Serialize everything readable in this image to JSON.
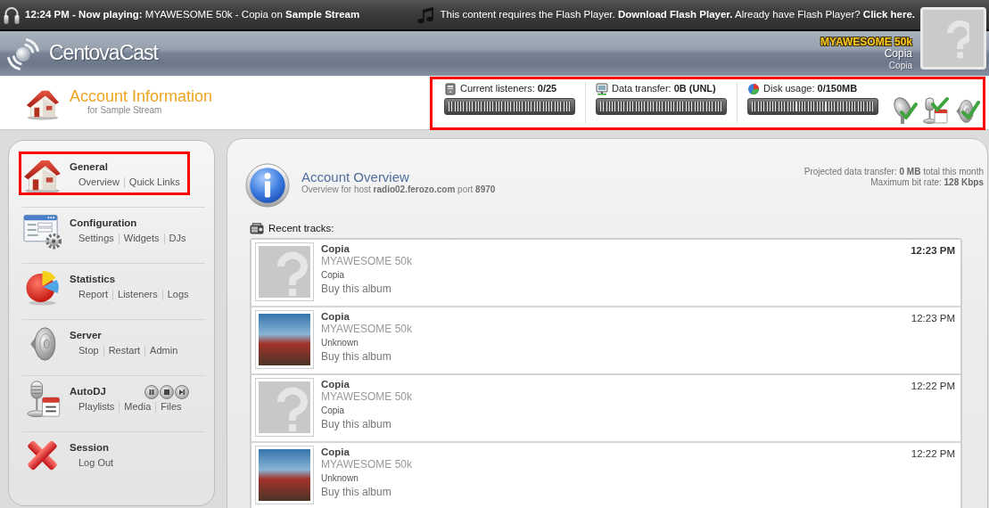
{
  "now_playing_bar": {
    "status": "**12:24 PM - Now playing:** MYAWESOME 50k - Copia on **Sample Stream**",
    "flash_notice": [
      {
        "kind": "text",
        "text": "This content requires the Flash Player."
      },
      {
        "kind": "link",
        "text": "Download Flash Player."
      },
      {
        "kind": "text",
        "text": "Already have Flash Player?"
      },
      {
        "kind": "link",
        "text": "Click here."
      }
    ]
  },
  "album_art": {
    "kind": "placeholder"
  },
  "header": {
    "logo": "CentovaCast",
    "now_playing": {
      "artist": "MYAWESOME 50k",
      "title": "Copia",
      "album": "Copia"
    }
  },
  "page_title": {
    "title": "Account Information",
    "subtitle": "for Sample Stream"
  },
  "usage": {
    "highlighted": true,
    "meters": [
      {
        "kind": "listeners",
        "label": "Current listeners:",
        "value": "0/25",
        "level": 0
      },
      {
        "kind": "transfer",
        "label": "Data transfer:",
        "value": "0B (UNL)",
        "level": 0
      },
      {
        "kind": "disk",
        "label": "Disk usage:",
        "value": "0/150MB",
        "level": 0
      }
    ]
  },
  "sidebar": {
    "items": [
      {
        "kind": "general",
        "title": "General",
        "links": [
          "Overview",
          "Quick Links"
        ],
        "highlighted": true
      },
      {
        "kind": "configuration",
        "title": "Configuration",
        "links": [
          "Settings",
          "Widgets",
          "DJs"
        ]
      },
      {
        "kind": "statistics",
        "title": "Statistics",
        "links": [
          "Report",
          "Listeners",
          "Logs"
        ]
      },
      {
        "kind": "server",
        "title": "Server",
        "links": [
          "Stop",
          "Restart",
          "Admin"
        ]
      },
      {
        "kind": "autodj",
        "title": "AutoDJ",
        "links": [
          "Playlists",
          "Media",
          "Files"
        ],
        "transport_controls": true
      },
      {
        "kind": "session",
        "title": "Session",
        "links": [
          "Log Out"
        ]
      }
    ]
  },
  "overview": {
    "title": "Account Overview",
    "subtitle": "Overview for host **radio02.ferozo.com** port **8970**",
    "stats": [
      "Projected data transfer: **0 MB** total this month",
      "Maximum bit rate: **128 Kbps**"
    ]
  },
  "recent_tracks": {
    "label": "Recent tracks:",
    "tracks": [
      {
        "title": "Copia",
        "artist": "MYAWESOME 50k",
        "album": "Copia",
        "link": "Buy this album",
        "time": "12:23 PM",
        "current": true,
        "cover": {
          "kind": "placeholder"
        }
      },
      {
        "title": "Copia",
        "artist": "MYAWESOME 50k",
        "album": "Unknown",
        "link": "Buy this album",
        "time": "12:23 PM",
        "current": false,
        "cover": {
          "kind": "photo"
        }
      },
      {
        "title": "Copia",
        "artist": "MYAWESOME 50k",
        "album": "Copia",
        "link": "Buy this album",
        "time": "12:22 PM",
        "current": false,
        "cover": {
          "kind": "placeholder"
        }
      },
      {
        "title": "Copia",
        "artist": "MYAWESOME 50k",
        "album": "Unknown",
        "link": "Buy this album",
        "time": "12:22 PM",
        "current": false,
        "cover": {
          "kind": "photo"
        }
      }
    ]
  }
}
